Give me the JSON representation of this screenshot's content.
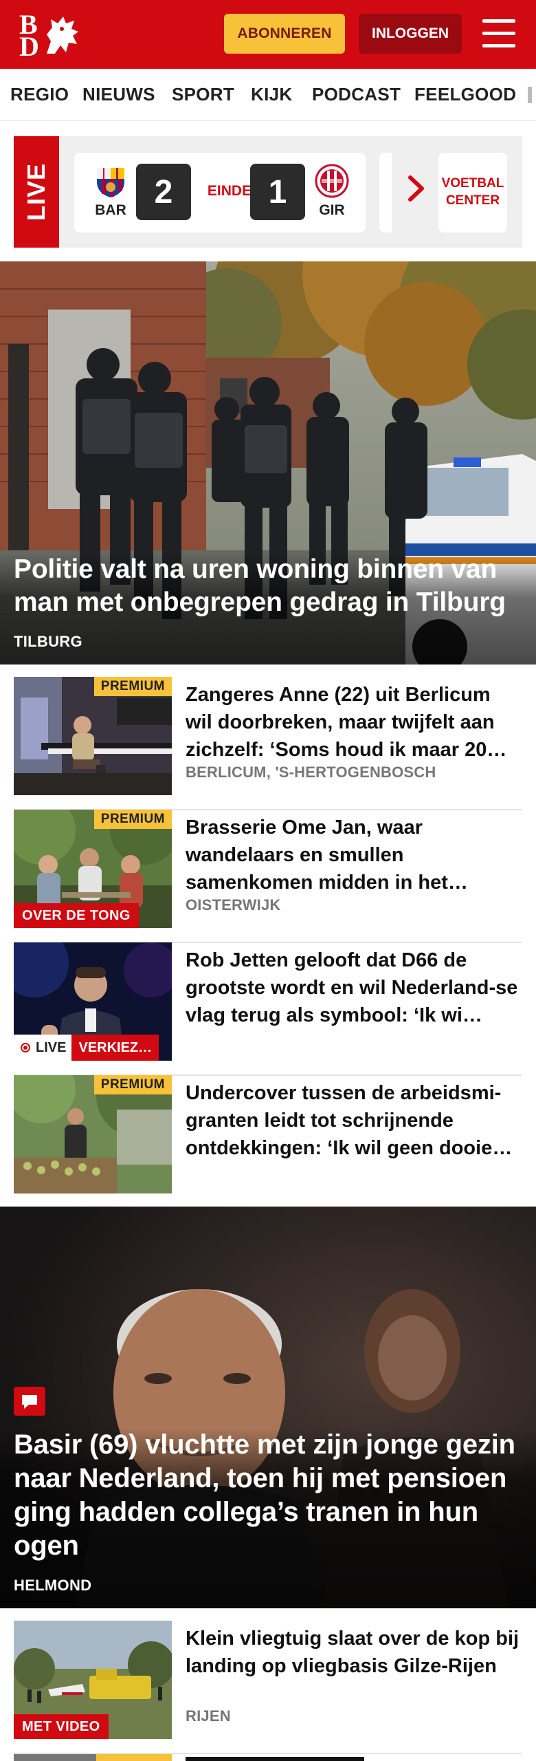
{
  "header": {
    "logo_letters": [
      "B",
      "D"
    ],
    "subscribe_label": "ABONNEREN",
    "login_label": "INLOGGEN",
    "brand_color": "#d10a11",
    "accent_color": "#f7c23a"
  },
  "nav": {
    "items": [
      "REGIO",
      "NIEUWS",
      "SPORT",
      "KIJK",
      "PODCAST",
      "FEELGOOD"
    ]
  },
  "live": {
    "label": "LIVE",
    "match": {
      "home_team": "BAR",
      "home_score": "2",
      "status": "EINDE",
      "away_score": "1",
      "away_team": "GIR"
    },
    "voetbal_center_line1": "VOETBAL",
    "voetbal_center_line2": "CENTER"
  },
  "hero_top": {
    "title": "Politie valt na uren woning binnen van man met onbegrepen gedrag in Tilburg",
    "location": "TILBURG"
  },
  "articles": [
    {
      "title": "Zangeres Anne (22) uit Berlicum wil doorbreken, maar twijfelt aan zichzelf: ‘Soms houd ik maar 20…",
      "location": "BERLICUM, 'S-HERTOGENBOSCH",
      "premium": "PREMIUM"
    },
    {
      "title": "Brasserie Ome Jan, waar wandelaars en smullen samenkomen midden in het…",
      "location": "OISTERWIJK",
      "premium": "PREMIUM",
      "tag": "OVER DE TONG"
    },
    {
      "title": "Rob Jetten gelooft dat D66 de grootste wordt en wil Nederland-se vlag terug als symbool: ‘Ik wi…",
      "live_label": "LIVE",
      "tag": "VERKIEZ…"
    },
    {
      "title": "Undercover tussen de arbeidsmi-granten leidt tot schrijnende ontdekkingen: ‘Ik wil geen dooie…",
      "premium": "PREMIUM"
    }
  ],
  "hero_second": {
    "title": "Basir (69) vluchtte met zijn jonge gezin naar Nederland, toen hij met pensioen ging hadden collega’s tranen in hun ogen",
    "location": "HELMOND",
    "icon": "comment-icon"
  },
  "article_after": {
    "title": "Klein vliegtuig slaat over de kop bij landing op vliegbasis Gilze-Rijen",
    "location": "RIJEN",
    "tag": "MET VIDEO"
  }
}
